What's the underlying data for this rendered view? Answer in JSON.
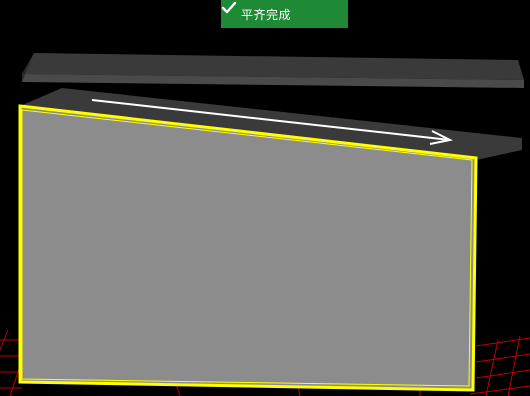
{
  "toast": {
    "message": "平齐完成",
    "icon": "check-icon",
    "background": "#1e8a36"
  },
  "scene": {
    "background": "#000000",
    "selection_color": "#ffff00",
    "arrow_color": "#ffffff",
    "grid_color": "#cc0000",
    "panel_color": "#8c8c8c",
    "slab_color": "#3c3c3c"
  }
}
